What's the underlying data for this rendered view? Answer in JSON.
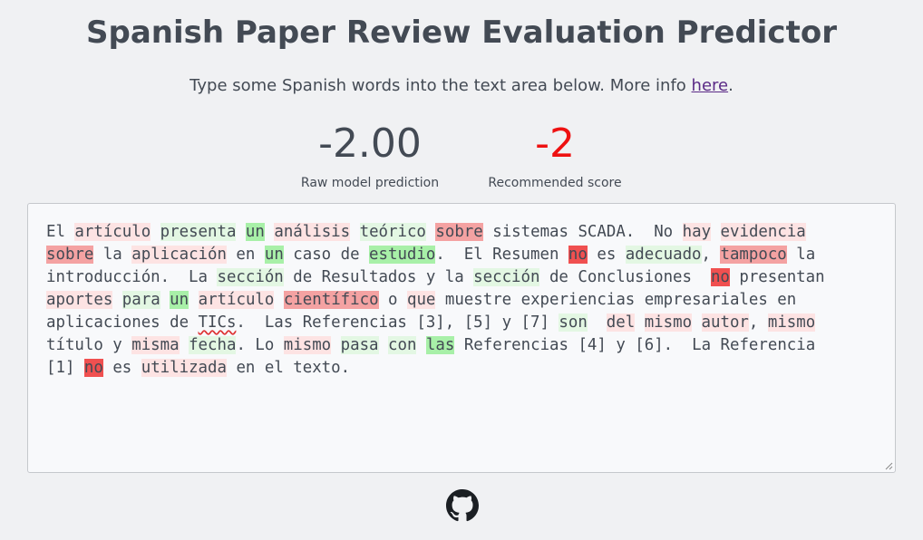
{
  "header": {
    "title": "Spanish Paper Review Evaluation Predictor",
    "subtitle_prefix": "Type some Spanish words into the text area below. More info ",
    "subtitle_link": "here",
    "subtitle_suffix": "."
  },
  "metrics": {
    "raw_value": "-2.00",
    "raw_label": "Raw model prediction",
    "recommended_value": "-2",
    "recommended_label": "Recommended score"
  },
  "editor": {
    "lines": [
      [
        {
          "t": "El ",
          "h": ""
        },
        {
          "t": "artículo",
          "h": "r1"
        },
        {
          "t": " ",
          "h": ""
        },
        {
          "t": "presenta",
          "h": "g1"
        },
        {
          "t": " ",
          "h": ""
        },
        {
          "t": "un",
          "h": "g2"
        },
        {
          "t": " ",
          "h": ""
        },
        {
          "t": "análisis",
          "h": "r1"
        },
        {
          "t": " ",
          "h": ""
        },
        {
          "t": "teórico",
          "h": "g1"
        },
        {
          "t": " ",
          "h": ""
        },
        {
          "t": "sobre",
          "h": "r2"
        },
        {
          "t": " sistemas SCADA.  No ",
          "h": ""
        },
        {
          "t": "hay",
          "h": "r1"
        },
        {
          "t": " ",
          "h": ""
        },
        {
          "t": "evidencia",
          "h": "r1"
        }
      ],
      [
        {
          "t": "sobre",
          "h": "r2"
        },
        {
          "t": " la ",
          "h": ""
        },
        {
          "t": "aplicación",
          "h": "r1"
        },
        {
          "t": " en ",
          "h": ""
        },
        {
          "t": "un",
          "h": "g2"
        },
        {
          "t": " caso de ",
          "h": ""
        },
        {
          "t": "estudio",
          "h": "g2"
        },
        {
          "t": ".  El Resumen ",
          "h": ""
        },
        {
          "t": "no",
          "h": "r3"
        },
        {
          "t": " es ",
          "h": ""
        },
        {
          "t": "adecuado",
          "h": "g1"
        },
        {
          "t": ", ",
          "h": ""
        },
        {
          "t": "tampoco",
          "h": "r2"
        },
        {
          "t": " la",
          "h": ""
        }
      ],
      [
        {
          "t": "introducción.  La ",
          "h": ""
        },
        {
          "t": "sección",
          "h": "g1"
        },
        {
          "t": " de Resultados y la ",
          "h": ""
        },
        {
          "t": "sección",
          "h": "g1"
        },
        {
          "t": " de Conclusiones  ",
          "h": ""
        },
        {
          "t": "no",
          "h": "r3"
        },
        {
          "t": " presentan",
          "h": ""
        }
      ],
      [
        {
          "t": "aportes",
          "h": "r1"
        },
        {
          "t": " ",
          "h": ""
        },
        {
          "t": "para",
          "h": "g1"
        },
        {
          "t": " ",
          "h": ""
        },
        {
          "t": "un",
          "h": "g2"
        },
        {
          "t": " ",
          "h": ""
        },
        {
          "t": "artículo",
          "h": "r1"
        },
        {
          "t": " ",
          "h": ""
        },
        {
          "t": "científico",
          "h": "r2"
        },
        {
          "t": " o ",
          "h": ""
        },
        {
          "t": "que",
          "h": "r1"
        },
        {
          "t": " muestre experiencias empresariales en",
          "h": ""
        }
      ],
      [
        {
          "t": "aplicaciones de ",
          "h": ""
        },
        {
          "t": "TICs",
          "h": "spell"
        },
        {
          "t": ".  Las Referencias [3], [5] y [7] ",
          "h": ""
        },
        {
          "t": "son",
          "h": "g1"
        },
        {
          "t": "  ",
          "h": ""
        },
        {
          "t": "del",
          "h": "r1"
        },
        {
          "t": " ",
          "h": ""
        },
        {
          "t": "mismo",
          "h": "r1"
        },
        {
          "t": " ",
          "h": ""
        },
        {
          "t": "autor",
          "h": "r1"
        },
        {
          "t": ", ",
          "h": ""
        },
        {
          "t": "mismo",
          "h": "r1"
        }
      ],
      [
        {
          "t": "título y ",
          "h": ""
        },
        {
          "t": "misma",
          "h": "r1"
        },
        {
          "t": " ",
          "h": ""
        },
        {
          "t": "fecha",
          "h": "g1"
        },
        {
          "t": ". Lo ",
          "h": ""
        },
        {
          "t": "mismo",
          "h": "r1"
        },
        {
          "t": " ",
          "h": ""
        },
        {
          "t": "pasa",
          "h": "g1"
        },
        {
          "t": " ",
          "h": ""
        },
        {
          "t": "con",
          "h": "g1"
        },
        {
          "t": " ",
          "h": ""
        },
        {
          "t": "las",
          "h": "g2"
        },
        {
          "t": " Referencias [4] y [6].  La Referencia",
          "h": ""
        }
      ],
      [
        {
          "t": "[1] ",
          "h": ""
        },
        {
          "t": "no",
          "h": "r3"
        },
        {
          "t": " es ",
          "h": ""
        },
        {
          "t": "utilizada",
          "h": "r1"
        },
        {
          "t": " en el texto.",
          "h": ""
        }
      ]
    ]
  },
  "footer": {
    "icon": "github-icon"
  },
  "colors": {
    "negative_light": "#fde3e3",
    "negative_medium": "#f4a2a2",
    "negative_strong": "#f05050",
    "positive_light": "#e3f7e3",
    "positive_medium": "#a8f0a8",
    "recommended_score": "#ee1111"
  }
}
